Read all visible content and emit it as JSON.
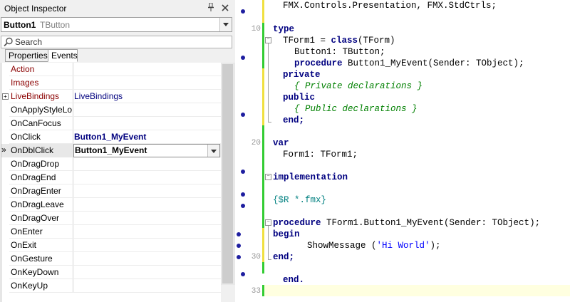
{
  "object_inspector": {
    "title": "Object Inspector",
    "pin_icon": "pin-icon",
    "close_icon": "close-icon",
    "component_name": "Button1",
    "component_class": "TButton",
    "search_placeholder": "Search",
    "tabs": [
      "Properties",
      "Events"
    ],
    "active_tab": "Events",
    "rows": [
      {
        "name": "Action",
        "value": "",
        "name_color": "red"
      },
      {
        "name": "Images",
        "value": "",
        "name_color": "red"
      },
      {
        "name": "LiveBindings",
        "value": "LiveBindings",
        "name_color": "red",
        "expandable": true
      },
      {
        "name": "OnApplyStyleLookup",
        "value": ""
      },
      {
        "name": "OnCanFocus",
        "value": ""
      },
      {
        "name": "OnClick",
        "value": "Button1_MyEvent"
      },
      {
        "name": "OnDblClick",
        "value": "Button1_MyEvent",
        "selected": true
      },
      {
        "name": "OnDragDrop",
        "value": ""
      },
      {
        "name": "OnDragEnd",
        "value": ""
      },
      {
        "name": "OnDragEnter",
        "value": ""
      },
      {
        "name": "OnDragLeave",
        "value": ""
      },
      {
        "name": "OnDragOver",
        "value": ""
      },
      {
        "name": "OnEnter",
        "value": ""
      },
      {
        "name": "OnExit",
        "value": ""
      },
      {
        "name": "OnGesture",
        "value": ""
      },
      {
        "name": "OnKeyDown",
        "value": ""
      },
      {
        "name": "OnKeyUp",
        "value": ""
      }
    ]
  },
  "editor": {
    "line_numbers": {
      "l10": "10",
      "l20": "20",
      "l30": "30",
      "l33": "33"
    },
    "lines": {
      "c0": "FMX.Controls.Presentation, FMX.StdCtrls;",
      "c2": "type",
      "c3a": "TForm1 = ",
      "c3b": "class",
      "c3c": "(TForm)",
      "c4": "Button1: TButton;",
      "c5a": "procedure",
      "c5b": " Button1_MyEvent(Sender: TObject);",
      "c6": "private",
      "c7": "{ Private declarations }",
      "c8": "public",
      "c9": "{ Public declarations }",
      "c10": "end;",
      "c12": "var",
      "c13": "Form1: TForm1;",
      "c15": "implementation",
      "c17": "{$R *.fmx}",
      "c19a": "procedure",
      "c19b": " TForm1.Button1_MyEvent(Sender: TObject);",
      "c20": "begin",
      "c21a": "ShowMessage (",
      "c21b": "'Hi World'",
      "c21c": ");",
      "c22": "end;",
      "c24": "end."
    }
  }
}
